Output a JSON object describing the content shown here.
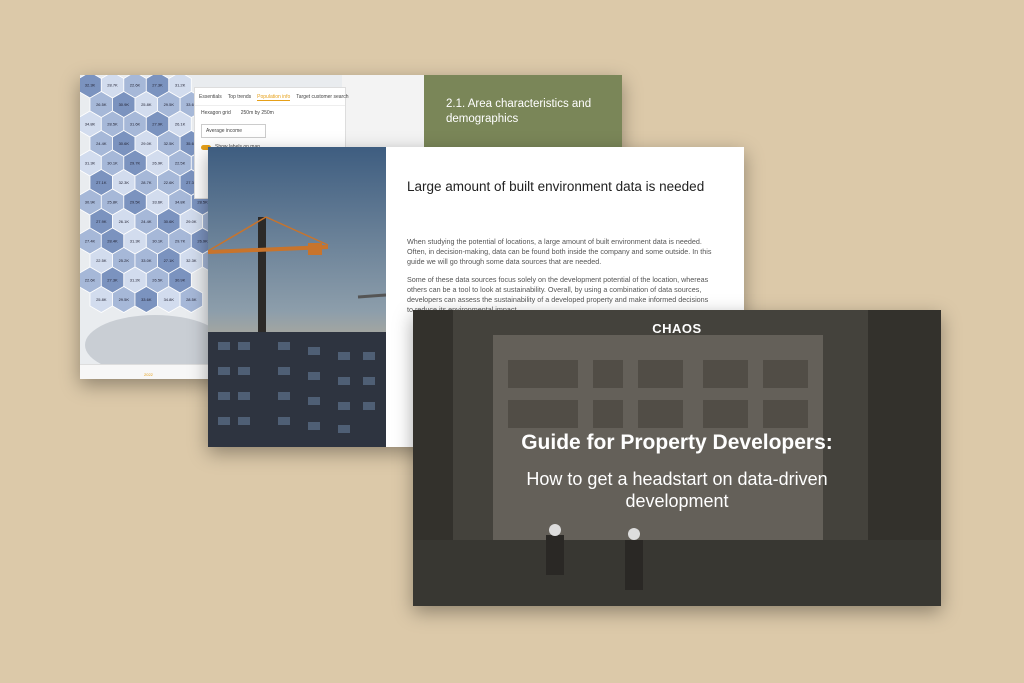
{
  "map_slide": {
    "section_title": "2.1. Area characteristics and demographics",
    "panel": {
      "tabs": [
        "Essentials",
        "Top trends",
        "Population info",
        "Target customer search"
      ],
      "active_tab_index": 2,
      "grid_option": "Hexagon grid",
      "cell_size": "250m by 250m",
      "metric_select": "Average income",
      "toggle_label": "Show labels on map"
    },
    "hex_labels": [
      "32.3K",
      "28.7K",
      "22.6K",
      "27.3K",
      "31.2K",
      "26.5K",
      "30.9K",
      "25.8K",
      "29.5K",
      "33.6K",
      "34.8K",
      "28.5K",
      "31.6K",
      "27.9K",
      "26.1K",
      "24.4K",
      "30.6K",
      "29.0K",
      "32.5K",
      "35.6K",
      "27.4K",
      "28.4K",
      "31.3K",
      "30.1K",
      "29.7K",
      "26.9K",
      "22.5K",
      "25.2K",
      "33.0K",
      "27.1K"
    ],
    "hex_colors": {
      "dark": "#7b93bf",
      "mid": "#a6b8d8",
      "light": "#d2dcee",
      "outline": "#ffffff"
    },
    "timeline_year": "2022"
  },
  "text_slide": {
    "heading": "Large amount of built environment data is needed",
    "paragraph_1": "When studying the potential of locations, a large amount of built environment data is needed. Often, in decision-making, data can be found both inside the company and some outside. In this guide we will go through some data sources that are needed.",
    "paragraph_2": "Some of these data sources focus solely on the development potential of the location, whereas others can be a tool to look at sustainability. Overall, by using a combination of data sources, developers can assess the sustainability of a developed property and make informed decisions to reduce its environmental impact."
  },
  "cover_slide": {
    "brand": "CHAOS",
    "title": "Guide for Property Developers:",
    "subtitle": "How to get a headstart on data-driven development"
  },
  "colors": {
    "background": "#dcc9a9",
    "accent_green": "#7a8658",
    "accent_orange": "#e6a019"
  }
}
